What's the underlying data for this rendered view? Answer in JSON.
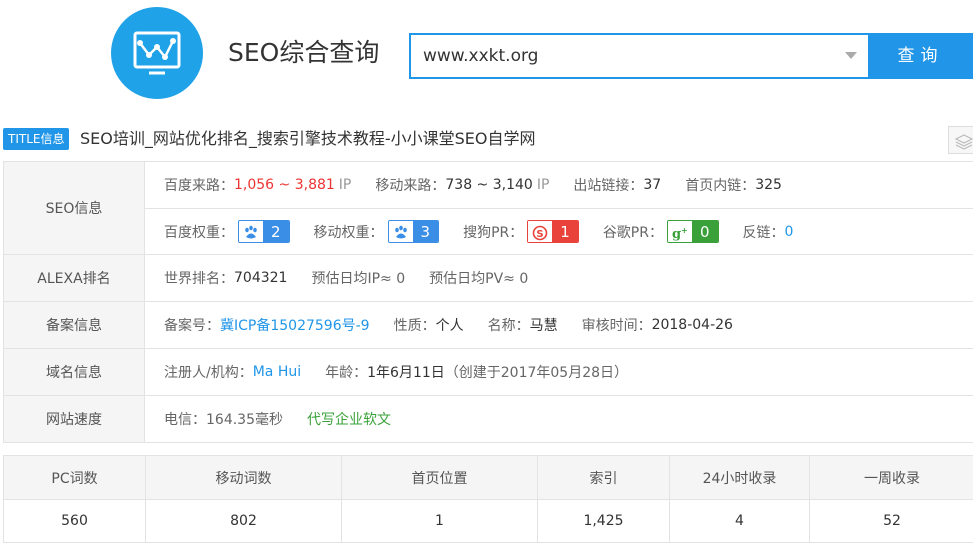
{
  "header": {
    "brand": "SEO综合查询",
    "search_value": "www.xxkt.org",
    "search_button": "查询",
    "accent": "#2196e8"
  },
  "title": {
    "badge": "TITLE信息",
    "text": "SEO培训_网站优化排名_搜索引擎技术教程-小小课堂SEO自学网"
  },
  "seo": {
    "label": "SEO信息",
    "baidu_traffic_label": "百度来路：",
    "baidu_traffic_value": "1,056 ~ 3,881",
    "baidu_traffic_unit": "IP",
    "mobile_traffic_label": "移动来路：",
    "mobile_traffic_value": "738 ~ 3,140",
    "mobile_traffic_unit": "IP",
    "outlinks_label": "出站链接：",
    "outlinks_value": "37",
    "inlinks_label": "首页内链：",
    "inlinks_value": "325",
    "baidu_weight_label": "百度权重：",
    "baidu_weight_value": "2",
    "mobile_weight_label": "移动权重：",
    "mobile_weight_value": "3",
    "sogou_pr_label": "搜狗PR：",
    "sogou_pr_value": "1",
    "google_pr_label": "谷歌PR：",
    "google_pr_value": "0",
    "backlinks_label": "反链：",
    "backlinks_value": "0"
  },
  "alexa": {
    "label": "ALEXA排名",
    "world_rank_label": "世界排名：",
    "world_rank_value": "704321",
    "daily_ip": "预估日均IP≈ 0",
    "daily_pv": "预估日均PV≈ 0"
  },
  "icp": {
    "label": "备案信息",
    "number_label": "备案号：",
    "number_value": "冀ICP备15027596号-9",
    "nature_label": "性质：",
    "nature_value": "个人",
    "name_label": "名称：",
    "name_value": "马慧",
    "date_label": "审核时间：",
    "date_value": "2018-04-26"
  },
  "domain": {
    "label": "域名信息",
    "registrant_label": "注册人/机构：",
    "registrant_value": "Ma Hui",
    "age_label": "年龄：",
    "age_value": "1年6月11日",
    "created": "（创建于2017年05月28日）"
  },
  "speed": {
    "label": "网站速度",
    "telecom": "电信：164.35毫秒",
    "ad_link": "代写企业软文"
  },
  "stats": {
    "headers": [
      "PC词数",
      "移动词数",
      "首页位置",
      "索引",
      "24小时收录",
      "一周收录"
    ],
    "values": [
      "560",
      "802",
      "1",
      "1,425",
      "4",
      "52"
    ]
  }
}
